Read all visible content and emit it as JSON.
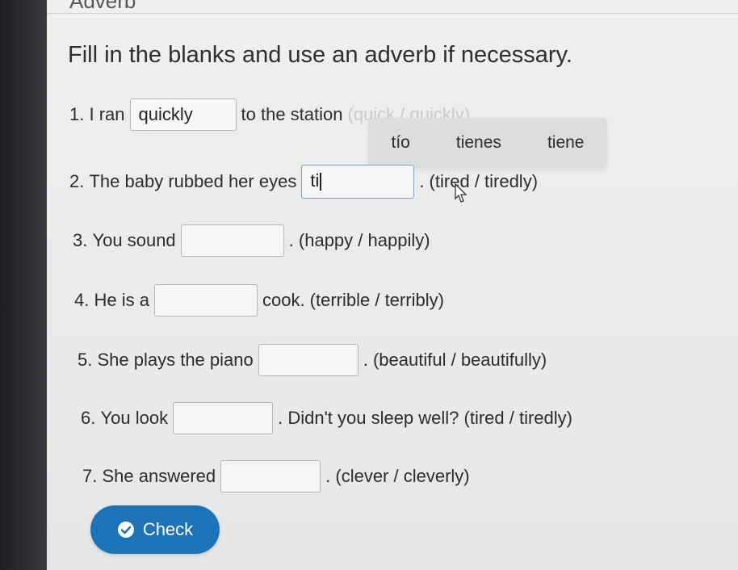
{
  "header": {
    "partial_heading": "Adverb"
  },
  "instruction": "Fill in the blanks and use an adverb if necessary.",
  "questions": [
    {
      "number": "1.",
      "before": "I ran",
      "answer": "quickly",
      "after": "to the station",
      "hint": "(quick / quickly)"
    },
    {
      "number": "2.",
      "before": "The baby rubbed her eyes",
      "answer": "ti",
      "after": ". (tired / tiredly)"
    },
    {
      "number": "3.",
      "before": "You sound",
      "answer": "",
      "after": ". (happy / happily)"
    },
    {
      "number": "4.",
      "before": "He is a",
      "answer": "",
      "after": "cook. (terrible / terribly)"
    },
    {
      "number": "5.",
      "before": "She plays the piano",
      "answer": "",
      "after": ". (beautiful / beautifully)"
    },
    {
      "number": "6.",
      "before": "You look",
      "answer": "",
      "after": ". Didn't you sleep well? (tired / tiredly)"
    },
    {
      "number": "7.",
      "before": "She answered",
      "answer": "",
      "after": ". (clever / cleverly)"
    }
  ],
  "suggestions": [
    "tío",
    "tienes",
    "tiene"
  ],
  "check_button": {
    "label": "Check"
  },
  "colors": {
    "accent": "#1d73b8",
    "active_border": "#7ea0c4"
  }
}
